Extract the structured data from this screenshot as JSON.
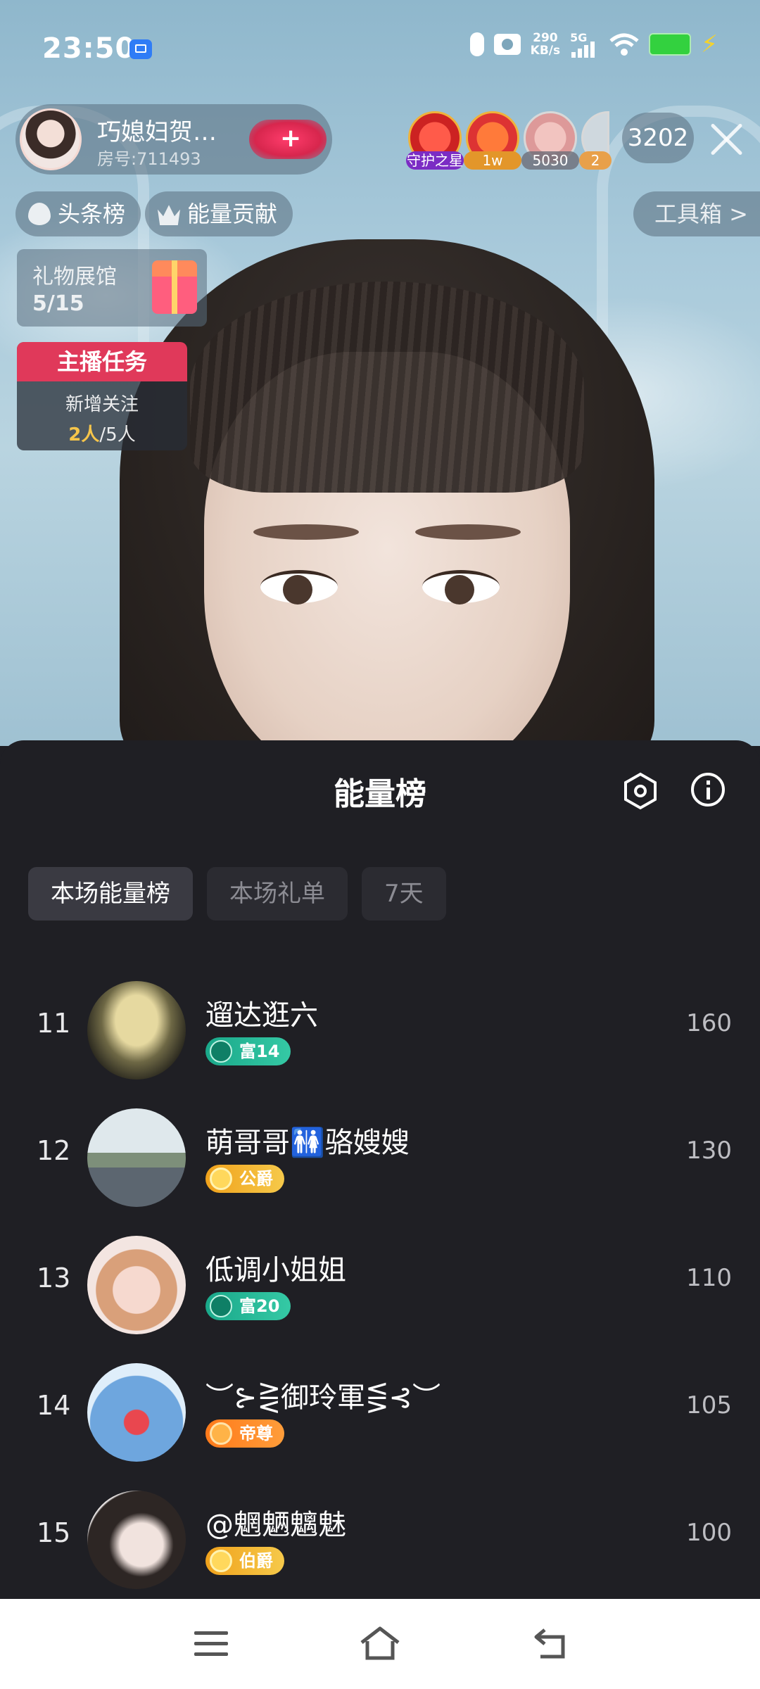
{
  "status_bar": {
    "time": "23:50",
    "net_speed_value": "290",
    "net_speed_unit": "KB/s",
    "network": "5G",
    "battery_color": "#33d13f"
  },
  "host": {
    "name": "巧媳妇贺…",
    "room": "房号:711493",
    "follow_label": "+"
  },
  "top_fans": [
    {
      "label": "守护之星"
    },
    {
      "label": "1w"
    },
    {
      "label": "5030"
    },
    {
      "label": "2"
    }
  ],
  "viewer_count": "3202",
  "chips": {
    "headlines": "头条榜",
    "energy": "能量贡献",
    "toolbox": "工具箱 >"
  },
  "gift_hall": {
    "title": "礼物展馆",
    "count": "5/15"
  },
  "task": {
    "title": "主播任务",
    "line1": "新增关注",
    "done": "2人",
    "total": "/5人"
  },
  "sheet": {
    "title": "能量榜",
    "tabs": [
      {
        "label": "本场能量榜",
        "active": true
      },
      {
        "label": "本场礼单",
        "active": false
      },
      {
        "label": "7天",
        "active": false
      }
    ]
  },
  "rows": [
    {
      "rank": "11",
      "name": "遛达逛六",
      "badge": "富14",
      "badge_type": "rich",
      "score": "160"
    },
    {
      "rank": "12",
      "name": "萌哥哥🚻骆嫂嫂",
      "badge": "公爵",
      "badge_type": "gold",
      "score": "130"
    },
    {
      "rank": "13",
      "name": "低调小姐姐",
      "badge": "富20",
      "badge_type": "rich",
      "score": "110"
    },
    {
      "rank": "14",
      "name": "︶⊱⋛御玲軍⋚⊰︶",
      "badge": "帝尊",
      "badge_type": "orange",
      "score": "105"
    },
    {
      "rank": "15",
      "name": "@魍魉魑魅",
      "badge": "伯爵",
      "badge_type": "gold",
      "score": "100"
    }
  ],
  "colors": {
    "accent_pink": "#e0395a",
    "sheet_bg": "#1f1f24",
    "rich_badge": "#1aa88a",
    "gold_badge": "#f0a21c",
    "orange_badge": "#ff7a1a"
  }
}
